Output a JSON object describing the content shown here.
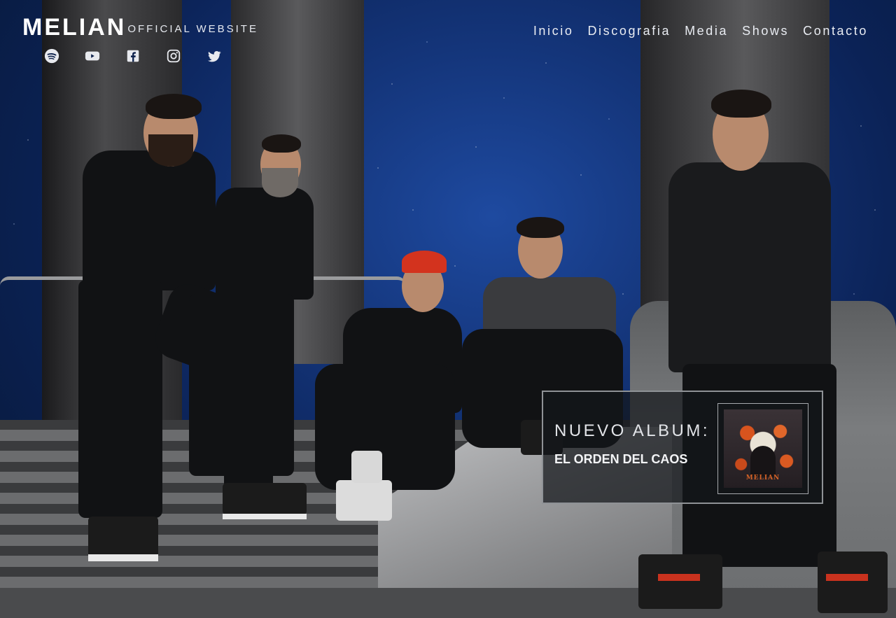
{
  "brand": {
    "name": "MELIAN",
    "tagline": "OFFICIAL WEBSITE"
  },
  "social_links": [
    {
      "icon": "spotify-icon"
    },
    {
      "icon": "youtube-icon"
    },
    {
      "icon": "facebook-icon"
    },
    {
      "icon": "instagram-icon"
    },
    {
      "icon": "twitter-icon"
    }
  ],
  "nav": {
    "items": [
      "Inicio",
      "Discografia",
      "Media",
      "Shows",
      "Contacto"
    ]
  },
  "album_promo": {
    "kicker": "NUEVO ALBUM:",
    "title": "EL ORDEN DEL CAOS",
    "cover_text": "MELIAN"
  },
  "colors": {
    "sky": "#14357a",
    "text": "#ffffff",
    "cover_accent": "#d66326"
  }
}
